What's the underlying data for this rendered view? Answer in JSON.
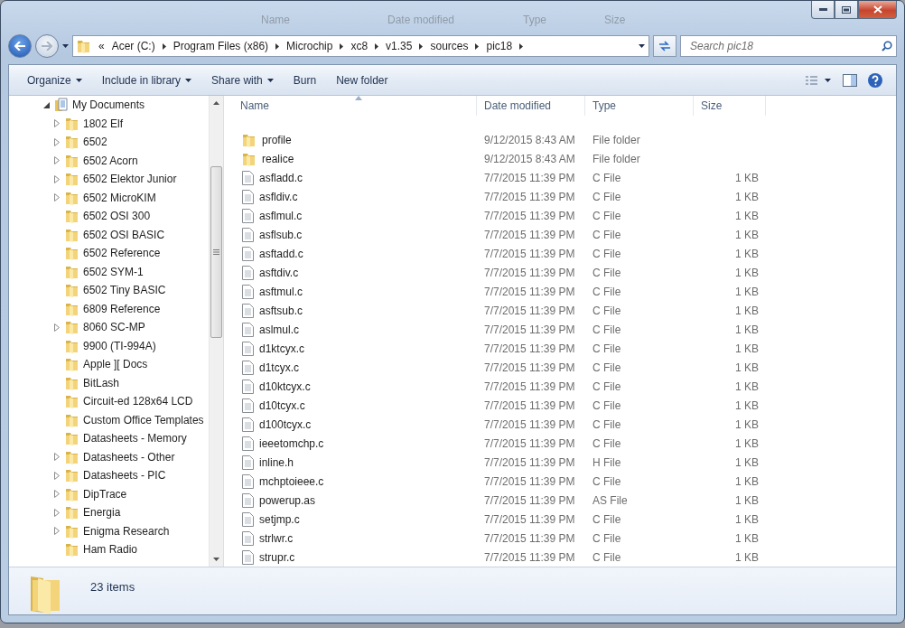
{
  "background_columns": [
    "Name",
    "Date modified",
    "Type",
    "Size"
  ],
  "address_bar": {
    "overflow": "«",
    "crumbs": [
      "Acer (C:)",
      "Program Files (x86)",
      "Microchip",
      "xc8",
      "v1.35",
      "sources",
      "pic18"
    ]
  },
  "search": {
    "placeholder": "Search pic18"
  },
  "toolbar": {
    "items": [
      {
        "label": "Organize",
        "dropdown": true
      },
      {
        "label": "Include in library",
        "dropdown": true
      },
      {
        "label": "Share with",
        "dropdown": true
      },
      {
        "label": "Burn",
        "dropdown": false
      },
      {
        "label": "New folder",
        "dropdown": false
      }
    ]
  },
  "navigation": {
    "items": [
      {
        "label": "My Documents",
        "kind": "documents",
        "expandable": true,
        "expanded": true,
        "children": [
          {
            "label": "1802 Elf",
            "kind": "folder",
            "expandable": true,
            "expanded": false
          },
          {
            "label": "6502",
            "kind": "folder",
            "expandable": true,
            "expanded": false
          },
          {
            "label": "6502 Acorn",
            "kind": "folder",
            "expandable": true,
            "expanded": false
          },
          {
            "label": "6502 Elektor Junior",
            "kind": "folder",
            "expandable": true,
            "expanded": false
          },
          {
            "label": "6502 MicroKIM",
            "kind": "folder",
            "expandable": true,
            "expanded": false
          },
          {
            "label": "6502 OSI 300",
            "kind": "folder",
            "expandable": false
          },
          {
            "label": "6502 OSI BASIC",
            "kind": "folder",
            "expandable": false
          },
          {
            "label": "6502 Reference",
            "kind": "folder",
            "expandable": false
          },
          {
            "label": "6502 SYM-1",
            "kind": "folder",
            "expandable": false
          },
          {
            "label": "6502 Tiny BASIC",
            "kind": "folder",
            "expandable": false
          },
          {
            "label": "6809 Reference",
            "kind": "folder",
            "expandable": false
          },
          {
            "label": "8060 SC-MP",
            "kind": "folder",
            "expandable": true,
            "expanded": false
          },
          {
            "label": "9900 (TI-994A)",
            "kind": "folder",
            "expandable": false
          },
          {
            "label": "Apple ][ Docs",
            "kind": "folder",
            "expandable": false
          },
          {
            "label": "BitLash",
            "kind": "folder",
            "expandable": false
          },
          {
            "label": "Circuit-ed 128x64 LCD",
            "kind": "folder",
            "expandable": false
          },
          {
            "label": "Custom Office Templates",
            "kind": "folder",
            "expandable": false
          },
          {
            "label": "Datasheets - Memory",
            "kind": "folder",
            "expandable": false
          },
          {
            "label": "Datasheets - Other",
            "kind": "folder",
            "expandable": true,
            "expanded": false
          },
          {
            "label": "Datasheets - PIC",
            "kind": "folder",
            "expandable": true,
            "expanded": false
          },
          {
            "label": "DipTrace",
            "kind": "folder",
            "expandable": true,
            "expanded": false
          },
          {
            "label": "Energia",
            "kind": "folder",
            "expandable": true,
            "expanded": false
          },
          {
            "label": "Enigma Research",
            "kind": "folder",
            "expandable": true,
            "expanded": false
          },
          {
            "label": "Ham Radio",
            "kind": "folder",
            "expandable": false
          }
        ]
      }
    ]
  },
  "table": {
    "columns": [
      {
        "label": "Name",
        "sorted": true
      },
      {
        "label": "Date modified",
        "sorted": false
      },
      {
        "label": "Type",
        "sorted": false
      },
      {
        "label": "Size",
        "sorted": false
      }
    ],
    "rows": [
      {
        "kind": "folder",
        "name": "profile",
        "date": "9/12/2015 8:43 AM",
        "type": "File folder"
      },
      {
        "kind": "folder",
        "name": "realice",
        "date": "9/12/2015 8:43 AM",
        "type": "File folder"
      },
      {
        "kind": "file",
        "name": "asfladd.c",
        "date": "7/7/2015 11:39 PM",
        "type": "C File",
        "size": "1 KB"
      },
      {
        "kind": "file",
        "name": "asfldiv.c",
        "date": "7/7/2015 11:39 PM",
        "type": "C File",
        "size": "1 KB"
      },
      {
        "kind": "file",
        "name": "asflmul.c",
        "date": "7/7/2015 11:39 PM",
        "type": "C File",
        "size": "1 KB"
      },
      {
        "kind": "file",
        "name": "asflsub.c",
        "date": "7/7/2015 11:39 PM",
        "type": "C File",
        "size": "1 KB"
      },
      {
        "kind": "file",
        "name": "asftadd.c",
        "date": "7/7/2015 11:39 PM",
        "type": "C File",
        "size": "1 KB"
      },
      {
        "kind": "file",
        "name": "asftdiv.c",
        "date": "7/7/2015 11:39 PM",
        "type": "C File",
        "size": "1 KB"
      },
      {
        "kind": "file",
        "name": "asftmul.c",
        "date": "7/7/2015 11:39 PM",
        "type": "C File",
        "size": "1 KB"
      },
      {
        "kind": "file",
        "name": "asftsub.c",
        "date": "7/7/2015 11:39 PM",
        "type": "C File",
        "size": "1 KB"
      },
      {
        "kind": "file",
        "name": "aslmul.c",
        "date": "7/7/2015 11:39 PM",
        "type": "C File",
        "size": "1 KB"
      },
      {
        "kind": "file",
        "name": "d1ktcyx.c",
        "date": "7/7/2015 11:39 PM",
        "type": "C File",
        "size": "1 KB"
      },
      {
        "kind": "file",
        "name": "d1tcyx.c",
        "date": "7/7/2015 11:39 PM",
        "type": "C File",
        "size": "1 KB"
      },
      {
        "kind": "file",
        "name": "d10ktcyx.c",
        "date": "7/7/2015 11:39 PM",
        "type": "C File",
        "size": "1 KB"
      },
      {
        "kind": "file",
        "name": "d10tcyx.c",
        "date": "7/7/2015 11:39 PM",
        "type": "C File",
        "size": "1 KB"
      },
      {
        "kind": "file",
        "name": "d100tcyx.c",
        "date": "7/7/2015 11:39 PM",
        "type": "C File",
        "size": "1 KB"
      },
      {
        "kind": "file",
        "name": "ieeetomchp.c",
        "date": "7/7/2015 11:39 PM",
        "type": "C File",
        "size": "1 KB"
      },
      {
        "kind": "file",
        "name": "inline.h",
        "date": "7/7/2015 11:39 PM",
        "type": "H File",
        "size": "1 KB"
      },
      {
        "kind": "file",
        "name": "mchptoieee.c",
        "date": "7/7/2015 11:39 PM",
        "type": "C File",
        "size": "1 KB"
      },
      {
        "kind": "file",
        "name": "powerup.as",
        "date": "7/7/2015 11:39 PM",
        "type": "AS File",
        "size": "1 KB"
      },
      {
        "kind": "file",
        "name": "setjmp.c",
        "date": "7/7/2015 11:39 PM",
        "type": "C File",
        "size": "1 KB"
      },
      {
        "kind": "file",
        "name": "strlwr.c",
        "date": "7/7/2015 11:39 PM",
        "type": "C File",
        "size": "1 KB"
      },
      {
        "kind": "file",
        "name": "strupr.c",
        "date": "7/7/2015 11:39 PM",
        "type": "C File",
        "size": "1 KB"
      }
    ]
  },
  "status_bar": {
    "text": "23 items"
  }
}
